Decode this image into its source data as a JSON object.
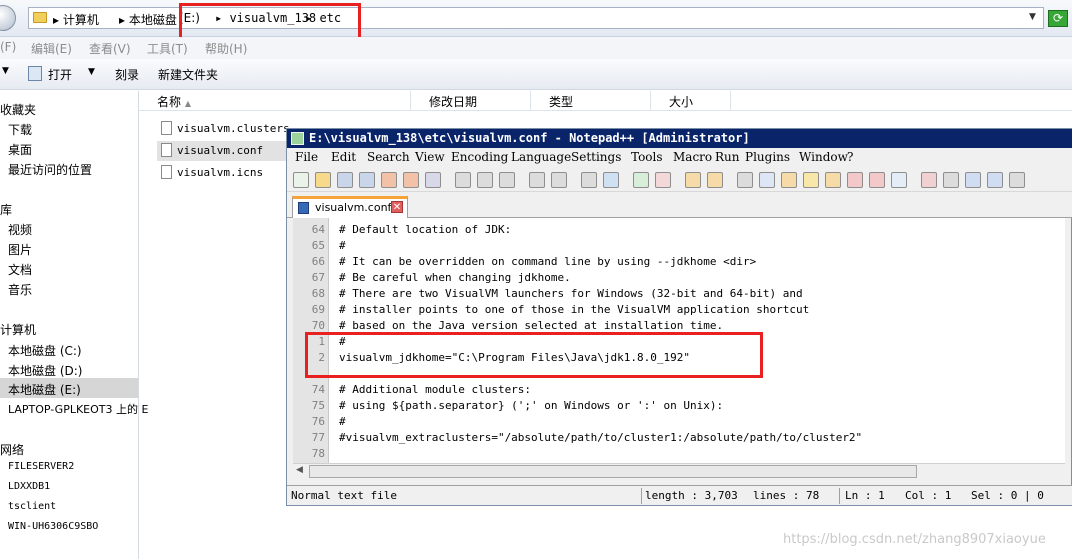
{
  "explorer": {
    "address": {
      "crumbs": [
        "计算机",
        "本地磁盘",
        "(E:)",
        "visualvm_138",
        "etc"
      ],
      "crumb_parts": [
        "▸ 计算机",
        "▸ 本地磁盘",
        "(E:)",
        "▸ visualvm_138",
        "▸ etc"
      ]
    },
    "menu": [
      "(F)",
      "编辑(E)",
      "查看(V)",
      "工具(T)",
      "帮助(H)"
    ],
    "toolbar": [
      "打开",
      "刻录",
      "新建文件夹"
    ],
    "nav": {
      "favorites_header": "收藏夹",
      "favorites": [
        "下载",
        "桌面",
        "最近访问的位置"
      ],
      "library_header": "库",
      "library": [
        "视频",
        "图片",
        "文档",
        "音乐"
      ],
      "computer_header": "计算机",
      "drives": [
        "本地磁盘 (C:)",
        "本地磁盘 (D:)",
        "本地磁盘 (E:)"
      ],
      "extra": "LAPTOP-GPLKEOT3 上的 E",
      "network_header": "网络",
      "network": [
        "FILESERVER2",
        "LDXXDB1",
        "tsclient",
        "WIN-UH6306C9SBO"
      ]
    },
    "columns": [
      "名称",
      "修改日期",
      "类型",
      "大小"
    ],
    "files": [
      "visualvm.clusters",
      "visualvm.conf",
      "visualvm.icns"
    ],
    "watermark": "https://blog.csdn.net/zhang8907xiaoyue"
  },
  "notepad": {
    "title": "E:\\visualvm_138\\etc\\visualvm.conf - Notepad++ [Administrator]",
    "menu": [
      "File",
      "Edit",
      "Search",
      "View",
      "Encoding",
      "Language",
      "Settings",
      "Tools",
      "Macro",
      "Run",
      "Plugins",
      "Window",
      "?"
    ],
    "tab": "visualvm.conf",
    "lines": [
      {
        "n": "64",
        "text": "# Default location of JDK:"
      },
      {
        "n": "65",
        "text": "#"
      },
      {
        "n": "66",
        "text": "# It can be overridden on command line by using --jdkhome <dir>"
      },
      {
        "n": "67",
        "text": "# Be careful when changing jdkhome."
      },
      {
        "n": "68",
        "text": "# There are two VisualVM launchers for Windows (32-bit and 64-bit) and"
      },
      {
        "n": "69",
        "text": "# installer points to one of those in the VisualVM application shortcut"
      },
      {
        "n": "70",
        "text": "# based on the Java version selected at installation time."
      },
      {
        "n": "1",
        "text": "#"
      },
      {
        "n": "2",
        "text": "visualvm_jdkhome=\"C:\\Program Files\\Java\\jdk1.8.0_192\""
      },
      {
        "n": "74",
        "text": "# Additional module clusters:"
      },
      {
        "n": "75",
        "text": "# using ${path.separator} (';' on Windows or ':' on Unix):"
      },
      {
        "n": "76",
        "text": "#"
      },
      {
        "n": "77",
        "text": "#visualvm_extraclusters=\"/absolute/path/to/cluster1:/absolute/path/to/cluster2\""
      },
      {
        "n": "78",
        "text": ""
      }
    ],
    "status": {
      "type": "Normal text file",
      "length": "length : 3,703",
      "lines": "lines : 78",
      "ln": "Ln : 1",
      "col": "Col : 1",
      "sel": "Sel : 0 | 0"
    }
  },
  "colors": {
    "highlight_box": "#e82020",
    "title_bar": "#0a246a",
    "tab_accent": "#f6a33a"
  }
}
